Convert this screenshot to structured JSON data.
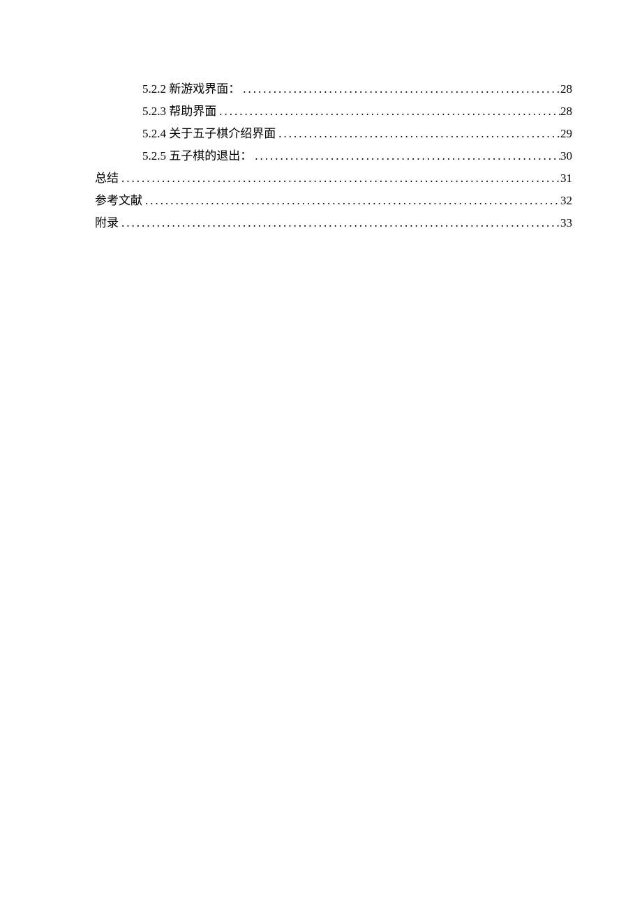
{
  "toc": [
    {
      "indent": 2,
      "title": "5.2.2 新游戏界面：",
      "page": "28"
    },
    {
      "indent": 2,
      "title": "5.2.3 帮助界面",
      "page": "28"
    },
    {
      "indent": 2,
      "title": "5.2.4 关于五子棋介绍界面",
      "page": "29"
    },
    {
      "indent": 2,
      "title": "5.2.5 五子棋的退出：",
      "page": "30"
    },
    {
      "indent": 0,
      "title": "总结",
      "page": "31"
    },
    {
      "indent": 0,
      "title": "参考文献",
      "page": "32"
    },
    {
      "indent": 0,
      "title": "附录",
      "page": "33"
    }
  ]
}
